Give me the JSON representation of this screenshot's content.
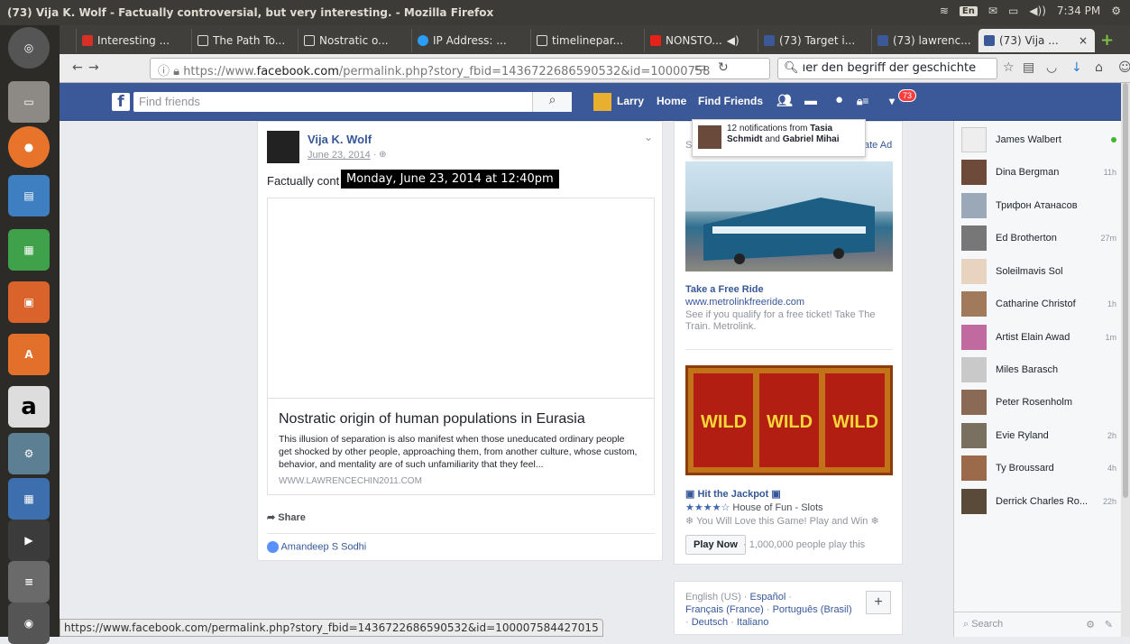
{
  "window_title": "(73) Vija K. Wolf - Factually controversial, but very interesting. - Mozilla Firefox",
  "tray": {
    "keyboard": "En",
    "time": "7:34 PM"
  },
  "tabs": [
    {
      "label": "Interesting ...",
      "color": "#d93025"
    },
    {
      "label": "The Path To...",
      "color": "#ffffff"
    },
    {
      "label": "Nostratic o...",
      "color": "#ffffff"
    },
    {
      "label": "IP Address: ...",
      "color": "#2a9df4"
    },
    {
      "label": "timelinepar...",
      "color": "#ffffff"
    },
    {
      "label": "NONSTO...",
      "color": "#e62117"
    },
    {
      "label": "(73) Target i...",
      "color": "#3b5998"
    },
    {
      "label": "(73) lawrenc...",
      "color": "#3b5998"
    },
    {
      "label": "(73) Vija ...",
      "color": "#3b5998"
    }
  ],
  "nav": {
    "url_pre": "https://www.",
    "url_host": "facebook.com",
    "url_post": "/permalink.php?story_fbid=1436722686590532&id=10000758",
    "search_text": "ıer den begriff der geschichte"
  },
  "fb": {
    "search_placeholder": "Find friends",
    "user": "Larry",
    "home": "Home",
    "find_friends": "Find Friends",
    "notif_count": "73"
  },
  "notification_popup": {
    "prefix": "12 notifications from ",
    "name1": "Tasia Schmidt",
    "mid": " and ",
    "name2": "Gabriel Mihai"
  },
  "post": {
    "author": "Vija K. Wolf",
    "date": "June 23, 2014",
    "text_visible": "Factually cont",
    "tooltip": "Monday, June 23, 2014 at 12:40pm",
    "link_title": "Nostratic origin of human populations in Eurasia",
    "link_desc": "This illusion of separation is also manifest when those uneducated ordinary people get shocked by other people, approaching them, from another culture, whose custom, behavior, and mentality are of such unfamiliarity that they feel...",
    "link_domain": "WWW.LAWRENCECHIN2011.COM",
    "share": "Share",
    "liker": "Amandeep S Sodhi"
  },
  "ads": {
    "header_left": "S",
    "header_right": "ate Ad",
    "ad1": {
      "title": "Take a Free Ride",
      "site": "www.metrolinkfreeride.com",
      "desc": "See if you qualify for a free ticket! Take The Train. Metrolink."
    },
    "ad2": {
      "title": "Hit the Jackpot",
      "rating": 4,
      "stars": "★★★★☆",
      "source": "House of Fun - Slots",
      "desc": "❄ You Will Love this Game! Play and Win ❄",
      "button": "Play Now",
      "social": "· 1,000,000 people play this"
    }
  },
  "languages": {
    "current": "English (US)",
    "l1": "Español",
    "l2": "Français (France)",
    "l3": "Português (Brasil)",
    "l4": "Deutsch",
    "l5": "Italiano"
  },
  "chat": [
    {
      "name": "James Walbert",
      "time": ""
    },
    {
      "name": "Dina Bergman",
      "time": "11h"
    },
    {
      "name": "Трифон Атанасов",
      "time": ""
    },
    {
      "name": "Ed Brotherton",
      "time": "27m"
    },
    {
      "name": "Soleilmavis Sol",
      "time": ""
    },
    {
      "name": "Catharine Christof",
      "time": "1h"
    },
    {
      "name": "Artist Elain Awad",
      "time": "1m"
    },
    {
      "name": "Miles Barasch",
      "time": ""
    },
    {
      "name": "Peter Rosenholm",
      "time": ""
    },
    {
      "name": "Evie Ryland",
      "time": "2h"
    },
    {
      "name": "Ty Broussard",
      "time": "4h"
    },
    {
      "name": "Derrick Charles Ro...",
      "time": "22h"
    }
  ],
  "chat_search_placeholder": "Search",
  "status_url": "https://www.facebook.com/permalink.php?story_fbid=1436722686590532&id=100007584427015"
}
